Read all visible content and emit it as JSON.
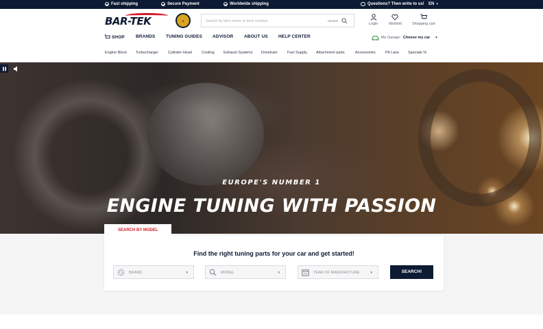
{
  "topbar": {
    "items": [
      "Fast shipping",
      "Secure Payment",
      "Worldwide shipping"
    ],
    "questions": "Questions? Then write to us!",
    "language": "EN"
  },
  "header": {
    "logo_text": "BAR-TEK",
    "search": {
      "placeholder": "Search by item name or item number",
      "remove_label": "remove"
    },
    "icons": {
      "login": "Login",
      "wishlist": "Wishlist",
      "cart": "Shopping cart"
    }
  },
  "nav": {
    "items": [
      "SHOP",
      "BRANDS",
      "TUNING GUIDES",
      "ADVISOR",
      "ABOUT US",
      "HELP CENTER"
    ],
    "garage_label": "My Garage:",
    "garage_value": "Choose my car"
  },
  "subnav": [
    "Engine Block",
    "Turbocharger",
    "Cylinder Head",
    "Cooling",
    "Exhaust Systems",
    "Drivetrain",
    "Fuel Supply",
    "Attachment parts",
    "Accessories",
    "Pit Lane",
    "Specials %"
  ],
  "hero": {
    "subtitle": "EUROPE'S NUMBER 1",
    "title": "ENGINE TUNING WITH PASSION"
  },
  "finder": {
    "tab": "SEARCH BY MODEL",
    "title": "Find the right tuning parts for your car and get started!",
    "brand_placeholder": "BRAND",
    "model_placeholder": "MODEL",
    "year_placeholder": "YEAR OF MANUFACTURE",
    "button": "SEARCH!"
  },
  "colors": {
    "navy": "#0d1a33",
    "brand_red": "#d4182b",
    "badge_gold": "#d9a520"
  }
}
